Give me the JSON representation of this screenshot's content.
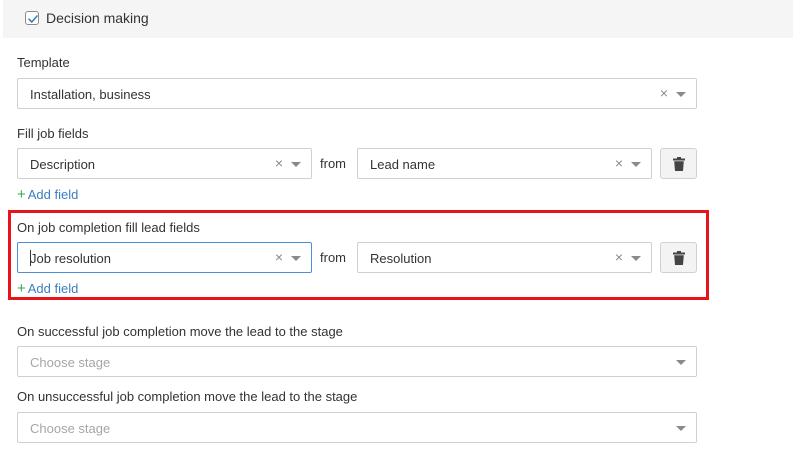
{
  "header": {
    "checked": true,
    "label": "Decision making"
  },
  "template": {
    "label": "Template",
    "value": "Installation, business"
  },
  "fill_job_fields": {
    "label": "Fill job fields",
    "row": {
      "target": "Description",
      "from_label": "from",
      "source": "Lead name"
    },
    "add_label": "Add field"
  },
  "completion_fill": {
    "label": "On job completion fill lead fields",
    "row": {
      "target": "Job resolution",
      "from_label": "from",
      "source": "Resolution"
    },
    "add_label": "Add field"
  },
  "success_stage": {
    "label": "On successful job completion move the lead to the stage",
    "placeholder": "Choose stage"
  },
  "fail_stage": {
    "label": "On unsuccessful job completion move the lead to the stage",
    "placeholder": "Choose stage"
  },
  "icons": {
    "clear": "×",
    "dropdown": "chevron-down-icon",
    "delete": "trash-icon",
    "add": "+"
  },
  "colors": {
    "highlight": "#e8141a",
    "link": "#3a7fc0",
    "plus": "#3aa557",
    "focus": "#4a90d9"
  }
}
